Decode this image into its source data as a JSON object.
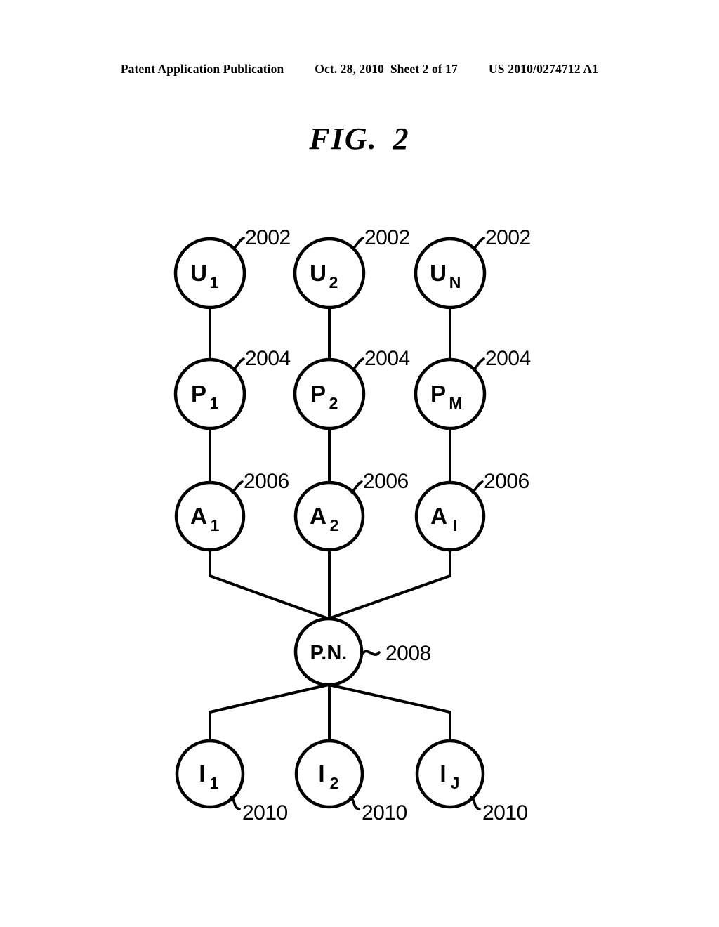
{
  "header": {
    "publication": "Patent Application Publication",
    "date": "Oct. 28, 2010",
    "sheet": "Sheet 2 of 17",
    "patent_number": "US 2010/0274712 A1"
  },
  "figure": {
    "label_word": "FIG.",
    "label_number": "2"
  },
  "diagram": {
    "rows": {
      "users": {
        "reference": "2002",
        "nodes": [
          {
            "base": "U",
            "sub": "1"
          },
          {
            "base": "U",
            "sub": "2"
          },
          {
            "base": "U",
            "sub": "N"
          }
        ]
      },
      "providers": {
        "reference": "2004",
        "nodes": [
          {
            "base": "P",
            "sub": "1"
          },
          {
            "base": "P",
            "sub": "2"
          },
          {
            "base": "P",
            "sub": "M"
          }
        ]
      },
      "accounts": {
        "reference": "2006",
        "nodes": [
          {
            "base": "A",
            "sub": "1"
          },
          {
            "base": "A",
            "sub": "2"
          },
          {
            "base": "A",
            "sub": "I"
          }
        ]
      },
      "hub": {
        "reference": "2008",
        "nodes": [
          {
            "base": "P.N.",
            "sub": ""
          }
        ]
      },
      "institutions": {
        "reference": "2010",
        "nodes": [
          {
            "base": "I",
            "sub": "1"
          },
          {
            "base": "I",
            "sub": "2"
          },
          {
            "base": "I",
            "sub": "J"
          }
        ]
      }
    }
  }
}
